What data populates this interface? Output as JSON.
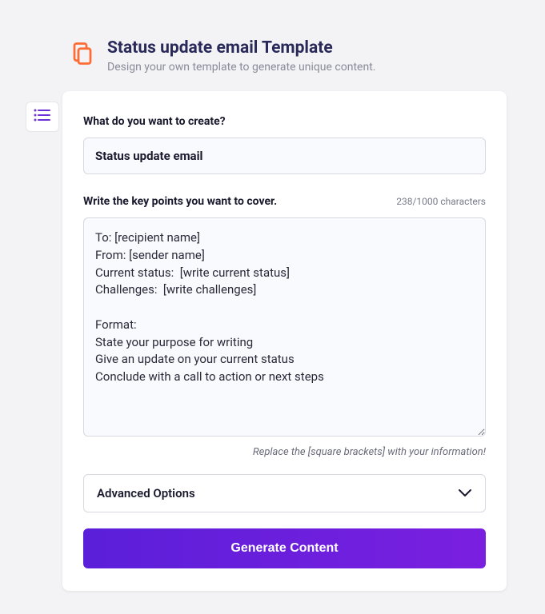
{
  "header": {
    "title": "Status update email Template",
    "subtitle": "Design your own template to generate unique content."
  },
  "form": {
    "create_label": "What do you want to create?",
    "create_value": "Status update email",
    "keypoints_label": "Write the key points you want to cover.",
    "char_count": "238/1000 characters",
    "keypoints_value": "To: [recipient name]\nFrom: [sender name]\nCurrent status:  [write current status]\nChallenges:  [write challenges]\n\nFormat:\nState your purpose for writing\nGive an update on your current status\nConclude with a call to action or next steps",
    "helper_text": "Replace the [square brackets] with your information!",
    "advanced_label": "Advanced Options",
    "generate_label": "Generate Content"
  }
}
